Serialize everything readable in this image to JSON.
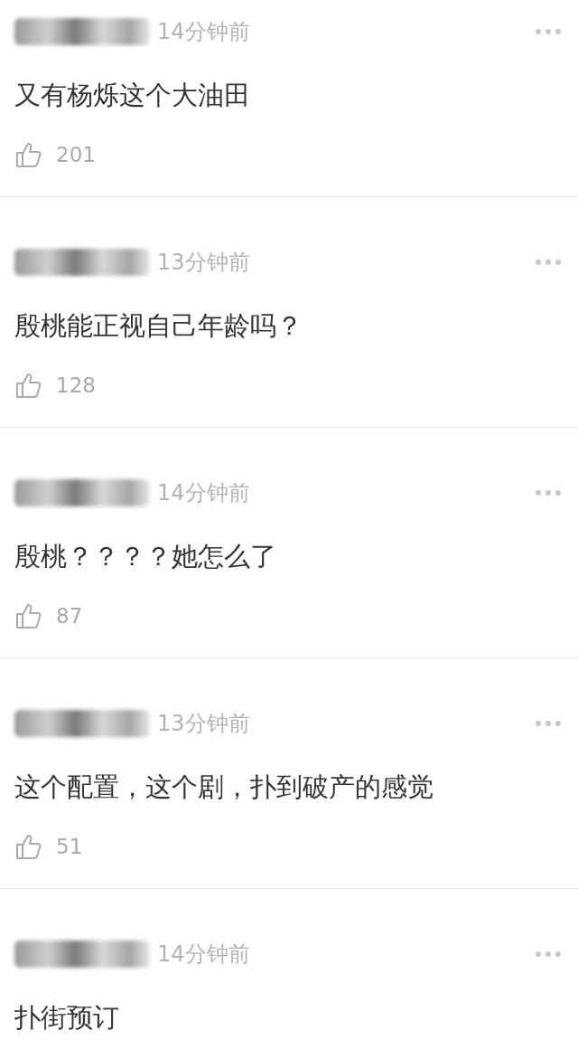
{
  "comments": [
    {
      "time": "14分钟前",
      "text": "又有杨烁这个大油田",
      "likes": "201"
    },
    {
      "time": "13分钟前",
      "text": "殷桃能正视自己年龄吗？",
      "likes": "128"
    },
    {
      "time": "14分钟前",
      "text": "殷桃？？？？她怎么了",
      "likes": "87"
    },
    {
      "time": "13分钟前",
      "text": "这个配置，这个剧，扑到破产的感觉",
      "likes": "51"
    },
    {
      "time": "14分钟前",
      "text": "扑街预订"
    }
  ]
}
